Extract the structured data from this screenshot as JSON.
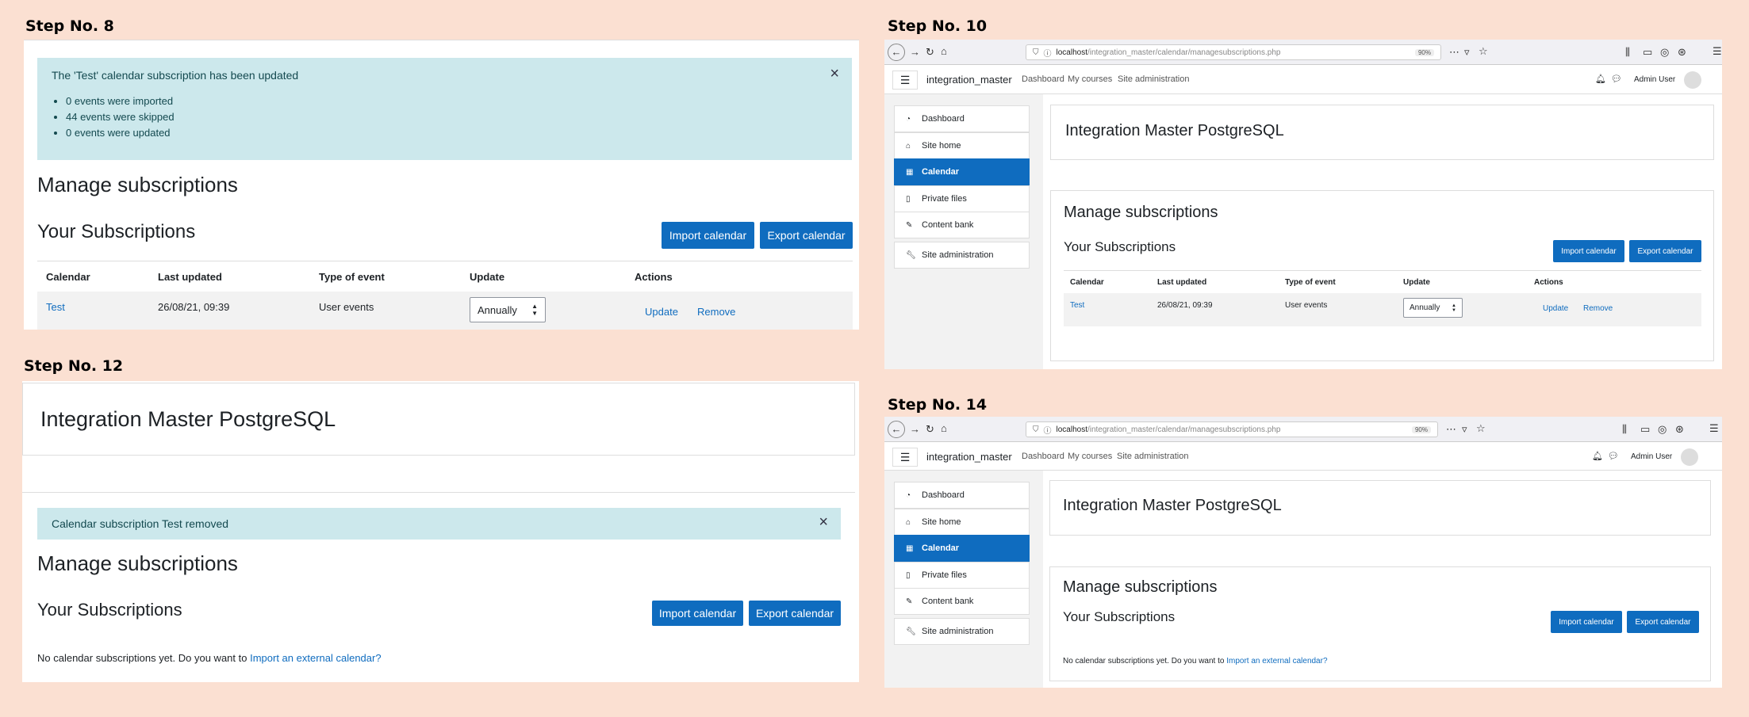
{
  "steps": {
    "s8": "Step No. 8",
    "s10": "Step No. 10",
    "s12": "Step No. 12",
    "s14": "Step No. 14"
  },
  "alerts": {
    "updated": "The 'Test' calendar subscription has been updated",
    "imported": "0 events were imported",
    "skipped": "44 events were skipped",
    "updated_count": "0 events were updated",
    "removed": "Calendar subscription Test removed",
    "close_glyph": "×"
  },
  "page": {
    "manage_heading": "Manage subscriptions",
    "subs_heading": "Your Subscriptions",
    "site_title": "Integration Master PostgreSQL",
    "import_btn": "Import calendar",
    "export_btn": "Export calendar",
    "no_subs_text": "No calendar subscriptions yet. Do you want to ",
    "no_subs_link": "Import an external calendar?"
  },
  "table": {
    "headers": [
      "Calendar",
      "Last updated",
      "Type of event",
      "Update",
      "Actions"
    ],
    "row": {
      "calendar": "Test",
      "last_updated": "26/08/21, 09:39",
      "type": "User events",
      "update_value": "Annually",
      "action_update": "Update",
      "action_remove": "Remove"
    }
  },
  "browser": {
    "url_host": "localhost",
    "url_path": "/integration_master/calendar/managesubscriptions.php",
    "zoom": "90%"
  },
  "moodle": {
    "site_name": "integration_master",
    "nav": [
      "Dashboard",
      "My courses",
      "Site administration"
    ],
    "user": "Admin User",
    "drawer": [
      "Dashboard",
      "Site home",
      "Calendar",
      "Private files",
      "Content bank"
    ],
    "drawer_admin": "Site administration"
  },
  "colors": {
    "accent": "#0f6cbf",
    "alert_bg": "#cce8ec",
    "page_bg": "#fbe0d2"
  }
}
